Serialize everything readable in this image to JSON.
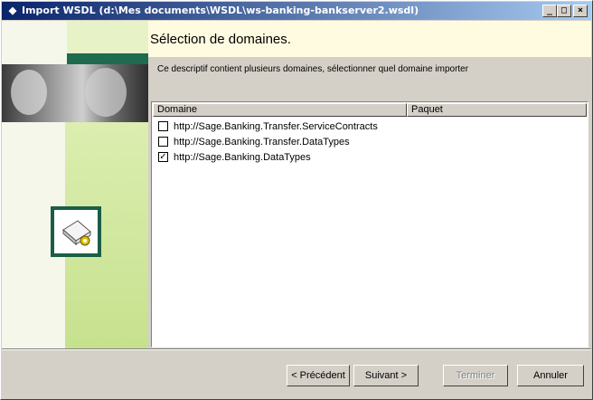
{
  "window": {
    "title": "Import WSDL (d:\\Mes documents\\WSDL\\ws-banking-bankserver2.wsdl)",
    "minimize_label": "_",
    "maximize_label": "□",
    "close_label": "×"
  },
  "header": {
    "title": "Sélection de domaines."
  },
  "description": "Ce descriptif contient plusieurs domaines, sélectionner quel domaine importer",
  "list": {
    "columns": [
      "Domaine",
      "Paquet"
    ],
    "rows": [
      {
        "domain": "http://Sage.Banking.Transfer.ServiceContracts",
        "package": "",
        "checked": false
      },
      {
        "domain": "http://Sage.Banking.Transfer.DataTypes",
        "package": "",
        "checked": false
      },
      {
        "domain": "http://Sage.Banking.DataTypes",
        "package": "",
        "checked": true
      }
    ]
  },
  "buttons": {
    "previous": "< Précédent",
    "next": "Suivant >",
    "finish": "Terminer",
    "cancel": "Annuler"
  },
  "icons": {
    "title_icon": "diamond-icon",
    "wizard_icon": "wsdl-import-icon"
  },
  "colors": {
    "title_bar_start": "#0a246a",
    "title_bar_end": "#a6caf0",
    "header_bg": "#fffbe0",
    "accent_green": "#1e6b50"
  }
}
